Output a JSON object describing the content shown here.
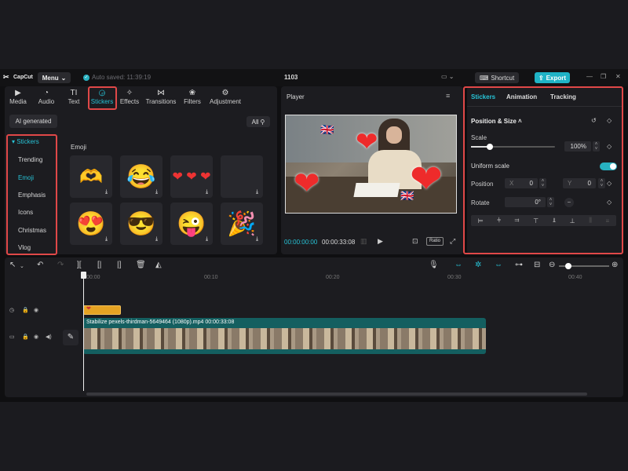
{
  "app": {
    "logo_text": "CapCut",
    "menu_label": "Menu",
    "autosave_text": "Auto saved: 11:39:19",
    "project_title": "1103",
    "shortcut_label": "Shortcut",
    "export_label": "Export"
  },
  "top_tabs": [
    {
      "label": "Media",
      "icon": "media-icon"
    },
    {
      "label": "Audio",
      "icon": "audio-icon"
    },
    {
      "label": "Text",
      "icon": "text-icon"
    },
    {
      "label": "Stickers",
      "icon": "stickers-icon",
      "active": true
    },
    {
      "label": "Effects",
      "icon": "effects-icon"
    },
    {
      "label": "Transitions",
      "icon": "transitions-icon"
    },
    {
      "label": "Filters",
      "icon": "filters-icon"
    },
    {
      "label": "Adjustment",
      "icon": "adjustment-icon"
    }
  ],
  "stickers_panel": {
    "ai_generated_label": "AI generated",
    "section_header": "Stickers",
    "categories": [
      "Trending",
      "Emoji",
      "Emphasis",
      "Icons",
      "Christmas",
      "Vlog"
    ],
    "active_category": "Emoji",
    "filter_label": "All",
    "grid_title": "Emoji"
  },
  "player": {
    "label": "Player",
    "current_time": "00:00:00:00",
    "total_time": "00:00:33:08",
    "ratio_label": "Ratio"
  },
  "inspector": {
    "tabs": [
      "Stickers",
      "Animation",
      "Tracking"
    ],
    "active_tab": "Stickers",
    "section_title": "Position & Size",
    "scale_label": "Scale",
    "scale_value": "100%",
    "scale_fraction": 0.22,
    "uniform_scale_label": "Uniform scale",
    "uniform_scale_on": true,
    "position_label": "Position",
    "pos_x_key": "X",
    "pos_x_value": "0",
    "pos_y_key": "Y",
    "pos_y_value": "0",
    "rotate_label": "Rotate",
    "rotate_value": "0°"
  },
  "timeline": {
    "ruler_marks": [
      "00:00",
      "00:10",
      "00:20",
      "00:30",
      "00:40"
    ],
    "clip_label": "Stabilize  pexels-thirdman-5649464 (1080p).mp4  00:00:33:08"
  },
  "colors": {
    "accent": "#27c3d6",
    "export_bg": "#1fb3c6",
    "highlight_border": "#e04848",
    "sticker_clip": "#e5a323",
    "video_clip": "#145f60"
  }
}
